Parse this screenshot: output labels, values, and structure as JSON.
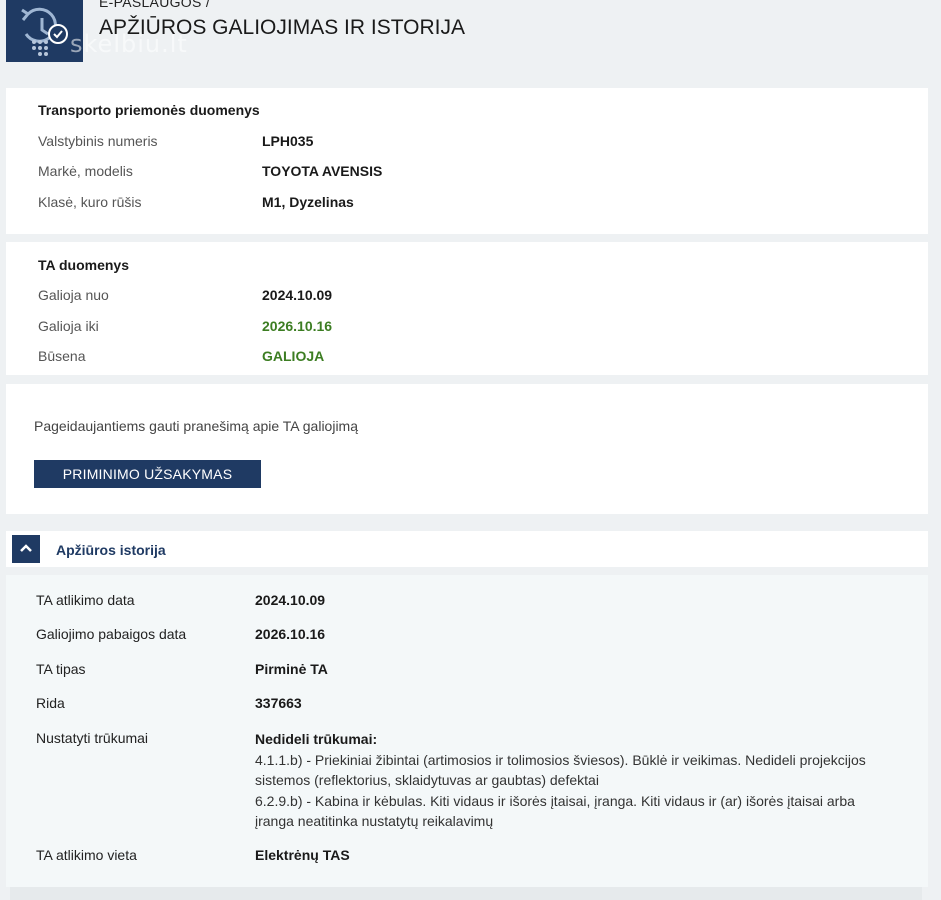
{
  "header": {
    "breadcrumb": "E-PASLAUGOS /",
    "title": "APŽIŪROS GALIOJIMAS IR ISTORIJA",
    "watermark": "skelbiu.lt",
    "logo_icon": "clock-check-icon",
    "brand_color": "#1f3a63"
  },
  "vehicle": {
    "heading": "Transporto priemonės duomenys",
    "rows": [
      {
        "label": "Valstybinis numeris",
        "value": "LPH035"
      },
      {
        "label": "Markė, modelis",
        "value": "TOYOTA AVENSIS"
      },
      {
        "label": "Klasė, kuro rūšis",
        "value": "M1, Dyzelinas"
      }
    ]
  },
  "ta": {
    "heading": "TA duomenys",
    "rows": [
      {
        "label": "Galioja nuo",
        "value": "2024.10.09"
      },
      {
        "label": "Galioja iki",
        "value": "2026.10.16"
      },
      {
        "label": "Būsena",
        "value": "GALIOJA"
      }
    ],
    "valid_color": "#3c7d22"
  },
  "reminder": {
    "text": "Pageidaujantiems gauti pranešimą apie TA galiojimą",
    "button_label": "PRIMINIMO UŽSAKYMAS"
  },
  "history": {
    "title": "Apžiūros istorija",
    "toggle_icon": "chevron-up-icon",
    "rows": [
      {
        "label": "TA atlikimo data",
        "value": "2024.10.09"
      },
      {
        "label": "Galiojimo pabaigos data",
        "value": "2026.10.16"
      },
      {
        "label": "TA tipas",
        "value": "Pirminė TA"
      },
      {
        "label": "Rida",
        "value": "337663"
      },
      {
        "label": "Nustatyti trūkumai",
        "value": ""
      },
      {
        "label": "TA atlikimo vieta",
        "value": "Elektrėnų TAS"
      }
    ],
    "defects": {
      "title": "Nedideli trūkumai:",
      "lines": [
        "4.1.1.b) - Priekiniai žibintai (artimosios ir tolimosios šviesos). Būklė ir veikimas. Nedideli projekcijos",
        "sistemos (reflektorius, sklaidytuvas ar gaubtas) defektai",
        "6.2.9.b) - Kabina ir kėbulas. Kiti vidaus ir išorės įtaisai, įranga. Kiti vidaus ir (ar) išorės įtaisai arba",
        "įranga neatitinka nustatytų reikalavimų"
      ]
    }
  }
}
